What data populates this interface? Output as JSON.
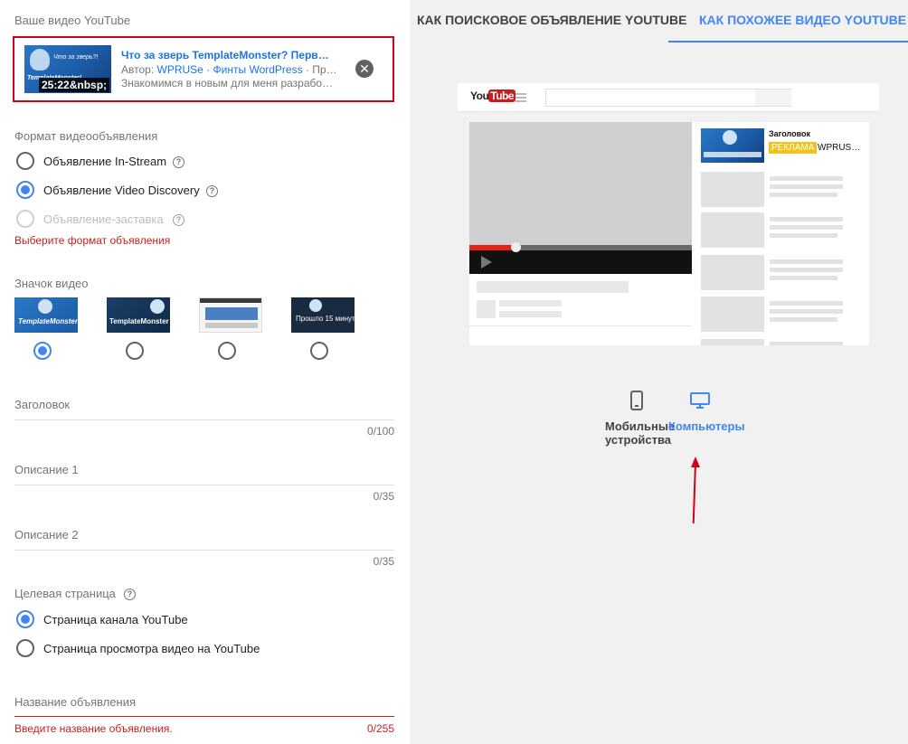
{
  "left_panel": {
    "your_video_label": "Ваше видео YouTube",
    "video_card": {
      "duration": "25:22&nbsp;",
      "thumb_logo": "TemplateMonster!",
      "thumb_caption": "Что за зверь?!",
      "title": "Что за зверь TemplateMonster? Перв…",
      "author_prefix": "Автор:",
      "author_name": "WPRUSe",
      "author_sep": "·",
      "author_channel": "Финты WordPress",
      "author_suffix": "· Про…",
      "description": "Знакомимся в новым для меня разрабо…",
      "close_icon": "close-icon"
    },
    "format": {
      "label": "Формат видеообъявления",
      "options": [
        {
          "label": "Объявление In-Stream",
          "state": "unchecked"
        },
        {
          "label": "Объявление Video Discovery",
          "state": "checked"
        },
        {
          "label": "Объявление-заставка",
          "state": "disabled"
        }
      ],
      "error": "Выберите формат объявления"
    },
    "thumbnail": {
      "label": "Значок видео",
      "options": [
        {
          "caption": "TemplateMonster!",
          "selected": true
        },
        {
          "caption": "TemplateMonster",
          "selected": false
        },
        {
          "caption": "",
          "selected": false
        },
        {
          "caption": "Прошло 15 минут",
          "selected": false
        }
      ]
    },
    "headline": {
      "label": "Заголовок",
      "counter": "0/100"
    },
    "description1": {
      "label": "Описание 1",
      "counter": "0/35"
    },
    "description2": {
      "label": "Описание 2",
      "counter": "0/35"
    },
    "landing": {
      "label": "Целевая страница",
      "options": [
        {
          "label": "Страница канала YouTube",
          "state": "checked"
        },
        {
          "label": "Страница просмотра видео на YouTube",
          "state": "unchecked"
        }
      ]
    },
    "ad_name": {
      "label": "Название объявления",
      "error": "Введите название объявления.",
      "counter": "0/255"
    }
  },
  "right_panel": {
    "tabs": [
      {
        "label": "КАК ПОИСКОВОЕ ОБЪЯВЛЕНИЕ YOUTUBE",
        "active": false
      },
      {
        "label": "КАК ПОХОЖЕЕ ВИДЕО YOUTUBE",
        "active": true
      }
    ],
    "preview": {
      "logo_you": "You",
      "logo_tube": "Tube",
      "ad_title": "Заголовок",
      "ad_badge": "РЕКЛАМА",
      "ad_channel": "WPRUS…"
    },
    "devices": {
      "mobile": {
        "line1": "Мобильные",
        "line2": "устройства",
        "icon": "smartphone-icon"
      },
      "desktop": {
        "label": "Компьютеры",
        "icon": "desktop-monitor-icon",
        "selected": true
      }
    },
    "colors": {
      "accent": "#4285f4",
      "error": "#c5221f",
      "highlight_border": "#d0021b"
    }
  }
}
